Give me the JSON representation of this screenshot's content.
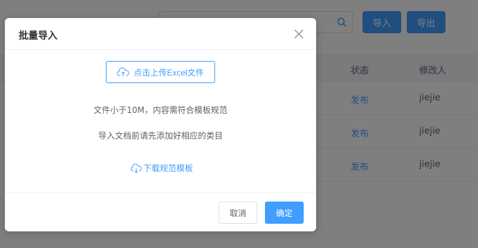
{
  "background": {
    "search": {
      "placeholder": ""
    },
    "toolbar": {
      "import_label": "导入",
      "export_label": "导出"
    },
    "table": {
      "headers": {
        "status": "状态",
        "modifier": "修改人"
      },
      "rows": [
        {
          "status": "发布",
          "modifier": "jiejie"
        },
        {
          "status": "发布",
          "modifier": "jiejie"
        },
        {
          "status": "发布",
          "modifier": "jiejie"
        }
      ]
    }
  },
  "dialog": {
    "title": "批量导入",
    "upload_label": "点击上传Excel文件",
    "hint_size": "文件小于10M，内容需符合模板规范",
    "hint_category": "导入文档前请先添加好相应的类目",
    "download_label": "下载规范模板",
    "cancel_label": "取消",
    "confirm_label": "确定"
  },
  "colors": {
    "primary": "#409eff",
    "overlay": "rgba(0,0,0,0.5)"
  }
}
